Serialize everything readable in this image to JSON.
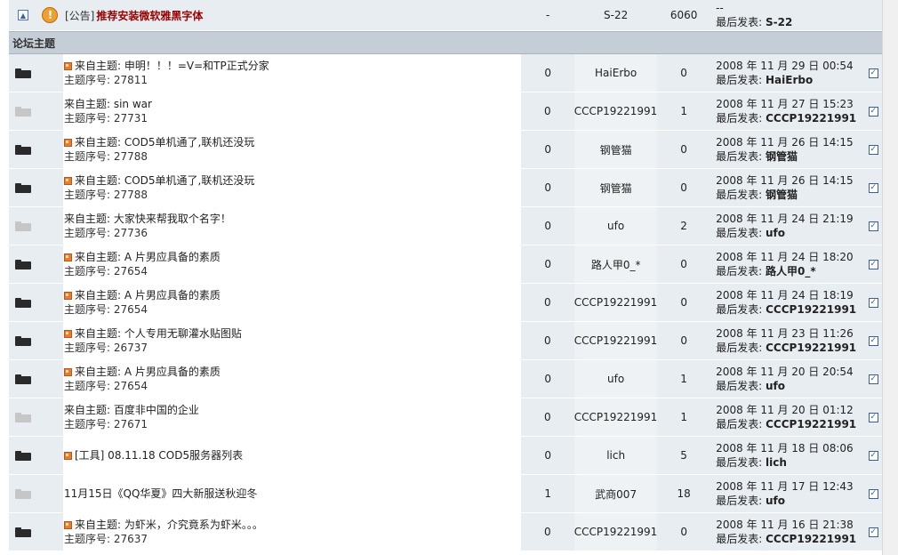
{
  "announcement": {
    "tag": "[公告]",
    "title": "推荐安装微软雅黑字体",
    "replies": "-",
    "author": "S-22",
    "views": "6060",
    "last_top": "--",
    "last_label": "最后发表:",
    "last_user": "S-22"
  },
  "section": {
    "title": "论坛主题"
  },
  "labels": {
    "last_post": "最后发表:"
  },
  "topics": [
    {
      "hot": true,
      "folder": "dark",
      "title": "来自主题: 申明！！！=V=和TP正式分家",
      "sub": "主题序号: 27811",
      "replies": "0",
      "author": "HaiErbo",
      "views": "0",
      "date": "2008 年 11 月 29 日 00:54",
      "last_user": "HaiErbo"
    },
    {
      "hot": false,
      "folder": "light",
      "title": "来自主题: sin war",
      "sub": "主题序号: 27731",
      "replies": "0",
      "author": "CCCP19221991",
      "views": "1",
      "date": "2008 年 11 月 27 日 15:23",
      "last_user": "CCCP19221991"
    },
    {
      "hot": true,
      "folder": "dark",
      "title": "来自主题: COD5单机通了,联机还没玩",
      "sub": "主题序号: 27788",
      "replies": "0",
      "author": "钢管猫",
      "views": "0",
      "date": "2008 年 11 月 26 日 14:15",
      "last_user": "钢管猫"
    },
    {
      "hot": true,
      "folder": "dark",
      "title": "来自主题: COD5单机通了,联机还没玩",
      "sub": "主题序号: 27788",
      "replies": "0",
      "author": "钢管猫",
      "views": "0",
      "date": "2008 年 11 月 26 日 14:15",
      "last_user": "钢管猫"
    },
    {
      "hot": false,
      "folder": "light",
      "title": "来自主题: 大家快来帮我取个名字！",
      "sub": "主题序号: 27736",
      "replies": "0",
      "author": "ufo",
      "views": "2",
      "date": "2008 年 11 月 24 日 21:19",
      "last_user": "ufo"
    },
    {
      "hot": true,
      "folder": "dark",
      "title": "来自主题: A 片男应具备的素质",
      "sub": "主题序号: 27654",
      "replies": "0",
      "author": "路人甲0_*",
      "views": "0",
      "date": "2008 年 11 月 24 日 18:20",
      "last_user": "路人甲0_*"
    },
    {
      "hot": true,
      "folder": "dark",
      "title": "来自主题: A 片男应具备的素质",
      "sub": "主题序号: 27654",
      "replies": "0",
      "author": "CCCP19221991",
      "views": "0",
      "date": "2008 年 11 月 24 日 18:19",
      "last_user": "CCCP19221991"
    },
    {
      "hot": true,
      "folder": "dark",
      "title": "来自主题: 个人专用无聊灌水贴图贴",
      "sub": "主题序号: 26737",
      "replies": "0",
      "author": "CCCP19221991",
      "views": "0",
      "date": "2008 年 11 月 23 日 11:26",
      "last_user": "CCCP19221991"
    },
    {
      "hot": true,
      "folder": "dark",
      "title": "来自主题: A 片男应具备的素质",
      "sub": "主题序号: 27654",
      "replies": "0",
      "author": "ufo",
      "views": "1",
      "date": "2008 年 11 月 20 日 20:54",
      "last_user": "ufo"
    },
    {
      "hot": false,
      "folder": "light",
      "title": "来自主题: 百度非中国的企业",
      "sub": "主题序号: 27671",
      "replies": "0",
      "author": "CCCP19221991",
      "views": "1",
      "date": "2008 年 11 月 20 日 01:12",
      "last_user": "CCCP19221991"
    },
    {
      "hot": true,
      "folder": "dark",
      "title": "[工具] 08.11.18 COD5服务器列表",
      "sub": "",
      "replies": "0",
      "author": "lich",
      "views": "5",
      "date": "2008 年 11 月 18 日 08:06",
      "last_user": "lich"
    },
    {
      "hot": false,
      "folder": "light",
      "title": "11月15日《QQ华夏》四大新服送秋迎冬",
      "sub": "",
      "replies": "1",
      "author": "武商007",
      "views": "18",
      "date": "2008 年 11 月 17 日 12:43",
      "last_user": "ufo"
    },
    {
      "hot": true,
      "folder": "dark",
      "title": "来自主题: 为虾米，介究竟系为虾米。。。",
      "sub": "主题序号: 27637",
      "replies": "0",
      "author": "CCCP19221991",
      "views": "0",
      "date": "2008 年 11 月 16 日 21:38",
      "last_user": "CCCP19221991"
    }
  ]
}
